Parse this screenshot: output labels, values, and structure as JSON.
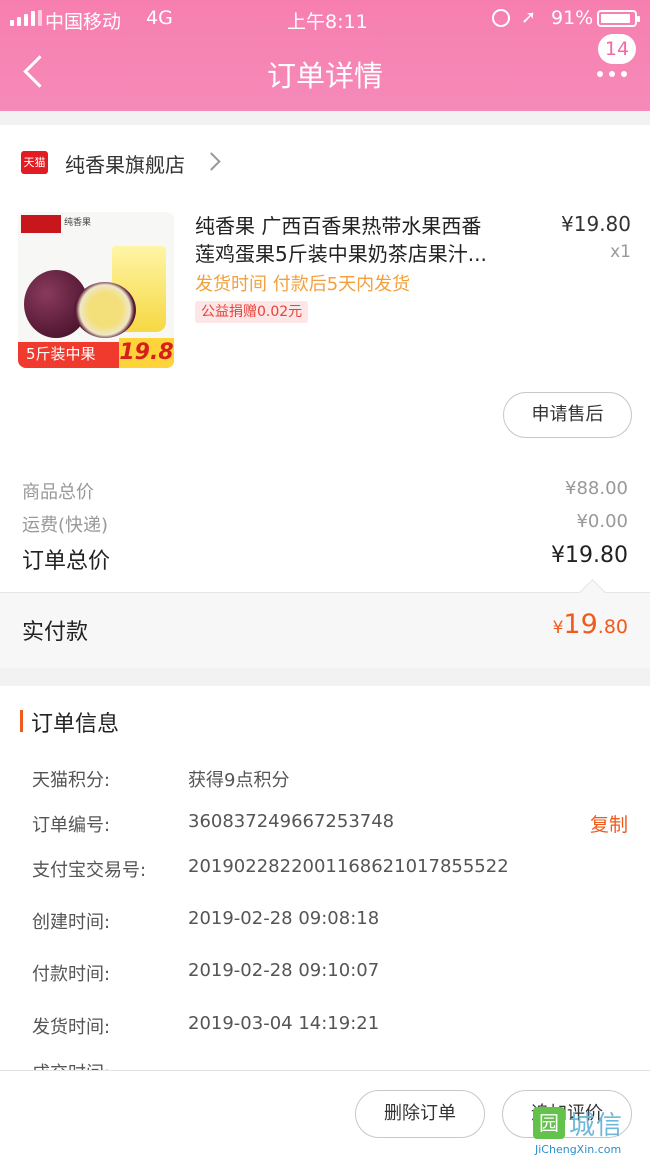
{
  "status_bar": {
    "carrier": "中国移动",
    "network": "4G",
    "time": "上午8:11",
    "location_glyph": "➚",
    "battery_text": "91%",
    "battery_level": 0.91
  },
  "header": {
    "title": "订单详情",
    "message_count": "14"
  },
  "shop": {
    "icon_text": "天猫",
    "name": "纯香果旗舰店"
  },
  "product": {
    "image": {
      "brand_text": "纯香果",
      "tag_text": "5斤装中果",
      "tag_price": "19.8"
    },
    "title_lines": [
      "纯香果 广西百香果热带水果西番",
      "莲鸡蛋果5斤装中果奶茶店果汁..."
    ],
    "price": "¥19.80",
    "quantity": "x1",
    "shipping_note": "发货时间 付款后5天内发货",
    "charity_badge": "公益捐赠0.02元",
    "after_sale_label": "申请售后"
  },
  "fees": {
    "goods_total_label": "商品总价",
    "goods_total_value": "¥88.00",
    "shipping_label": "运费(快递)",
    "shipping_value": "¥0.00",
    "order_total_label": "订单总价",
    "order_total_value": "¥19.80"
  },
  "payment": {
    "label": "实付款",
    "currency": "¥",
    "amount_int": "19",
    "amount_dec": ".80"
  },
  "order_info": {
    "title": "订单信息",
    "rows": [
      {
        "label": "天猫积分:",
        "value": "获得9点积分"
      },
      {
        "label": "订单编号:",
        "value": "360837249667253748"
      },
      {
        "label": "支付宝交易号:",
        "value": "2019022822001168621017855522"
      },
      {
        "label": "创建时间:",
        "value": "2019-02-28 09:08:18"
      },
      {
        "label": "付款时间:",
        "value": "2019-02-28 09:10:07"
      },
      {
        "label": "发货时间:",
        "value": "2019-03-04 14:19:21"
      }
    ],
    "copy_label": "复制",
    "cut_row_label": "成交时间:"
  },
  "bottom_bar": {
    "delete_label": "删除订单",
    "review_label": "追加评价"
  },
  "watermark": {
    "mark": "园",
    "name": "城信",
    "url": "JiChengXin.com"
  },
  "colors": {
    "header_pink": "#f77fb0",
    "accent_orange": "#f05a1c",
    "shipping_orange": "#f3a03c",
    "tmall_red": "#e31c23"
  }
}
